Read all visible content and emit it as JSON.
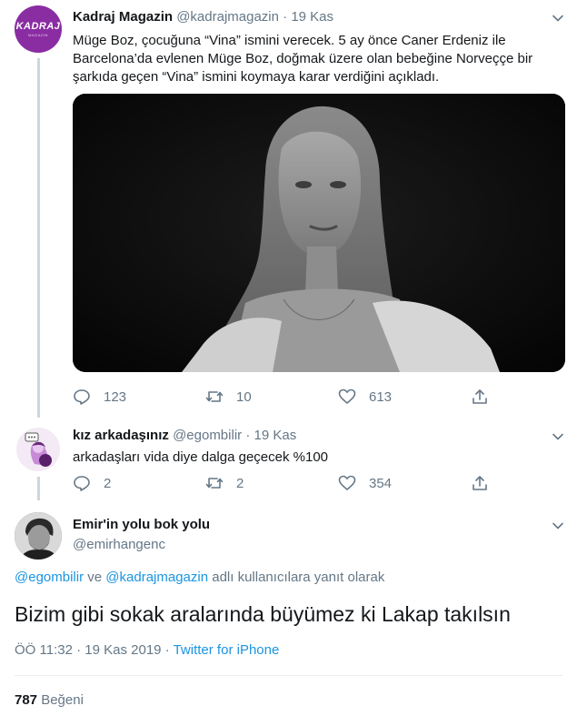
{
  "tweet1": {
    "name": "Kadraj Magazin",
    "handle": "@kadrajmagazin",
    "separator": "·",
    "date": "19 Kas",
    "avatar_text": "KADRAJ",
    "avatar_subtext": "MAGAZIN",
    "text": "Müge Boz, çocuğuna “Vina” ismini verecek. 5 ay önce Caner Erdeniz ile Barcelona’da evlenen Müge Boz, doğmak üzere olan bebeğine Norveççe bir şarkıda geçen “Vina” ismini koymaya karar verdiğini açıkladı.",
    "replies": "123",
    "retweets": "10",
    "likes": "613"
  },
  "tweet2": {
    "name": "kız arkadaşınız",
    "handle": "@egombilir",
    "separator": "·",
    "date": "19 Kas",
    "text": "arkadaşları vida diye dalga geçecek %100",
    "replies": "2",
    "retweets": "2",
    "likes": "354"
  },
  "main": {
    "name": "Emir'in yolu bok yolu",
    "handle": "@emirhangenc",
    "reply_mention1": "@egombilir",
    "reply_and": " ve ",
    "reply_mention2": "@kadrajmagazin",
    "reply_suffix": " adlı kullanıcılara yanıt olarak",
    "text": "Bizim gibi sokak aralarında büyümez ki Lakap takılsın",
    "time": "ÖÖ 11:32",
    "date": "19 Kas 2019",
    "separator": " · ",
    "source": "Twitter for iPhone",
    "like_count": "787",
    "like_label": "Beğeni"
  },
  "colors": {
    "link": "#1b95e0",
    "secondary": "#657786",
    "brand_avatar": "#8a2da3"
  }
}
